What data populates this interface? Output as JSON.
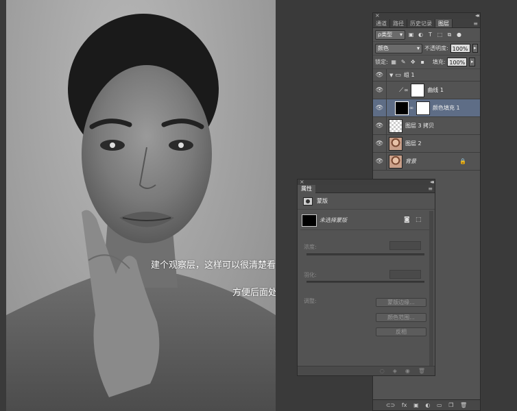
{
  "canvas": {
    "caption_line1": "建个观察层，这样可以很清楚看到皮肤脏的程度",
    "caption_line2": "方便后面处理"
  },
  "layers_panel": {
    "tabs": [
      "通道",
      "路径",
      "历史记录",
      "图层"
    ],
    "active_tab": "图层",
    "filter_label": "ρ类型",
    "blend_mode": "颜色",
    "opacity_label": "不透明度:",
    "opacity_value": "100%",
    "lock_label": "锁定:",
    "fill_label": "填充:",
    "fill_value": "100%",
    "layers": [
      {
        "name": "组 1",
        "type": "group"
      },
      {
        "name": "曲线 1",
        "type": "adjustment"
      },
      {
        "name": "颜色填充 1",
        "type": "fill",
        "selected": true
      },
      {
        "name": "图层 3 拷贝",
        "type": "transparent"
      },
      {
        "name": "图层 2",
        "type": "photo"
      },
      {
        "name": "背景",
        "type": "background",
        "locked": true
      }
    ],
    "footer_icons": [
      "link-icon",
      "fx",
      "mask-icon",
      "adjustment-icon",
      "folder-icon",
      "new-layer-icon",
      "trash-icon"
    ]
  },
  "properties_panel": {
    "tab": "属性",
    "section": "蒙版",
    "mask_status": "未选择蒙版",
    "density_label": "浓度:",
    "feather_label": "羽化:",
    "adjust_label": "调整:",
    "btn_mask_edge": "蒙版边缘...",
    "btn_color_range": "颜色范围...",
    "btn_invert": "反相"
  }
}
